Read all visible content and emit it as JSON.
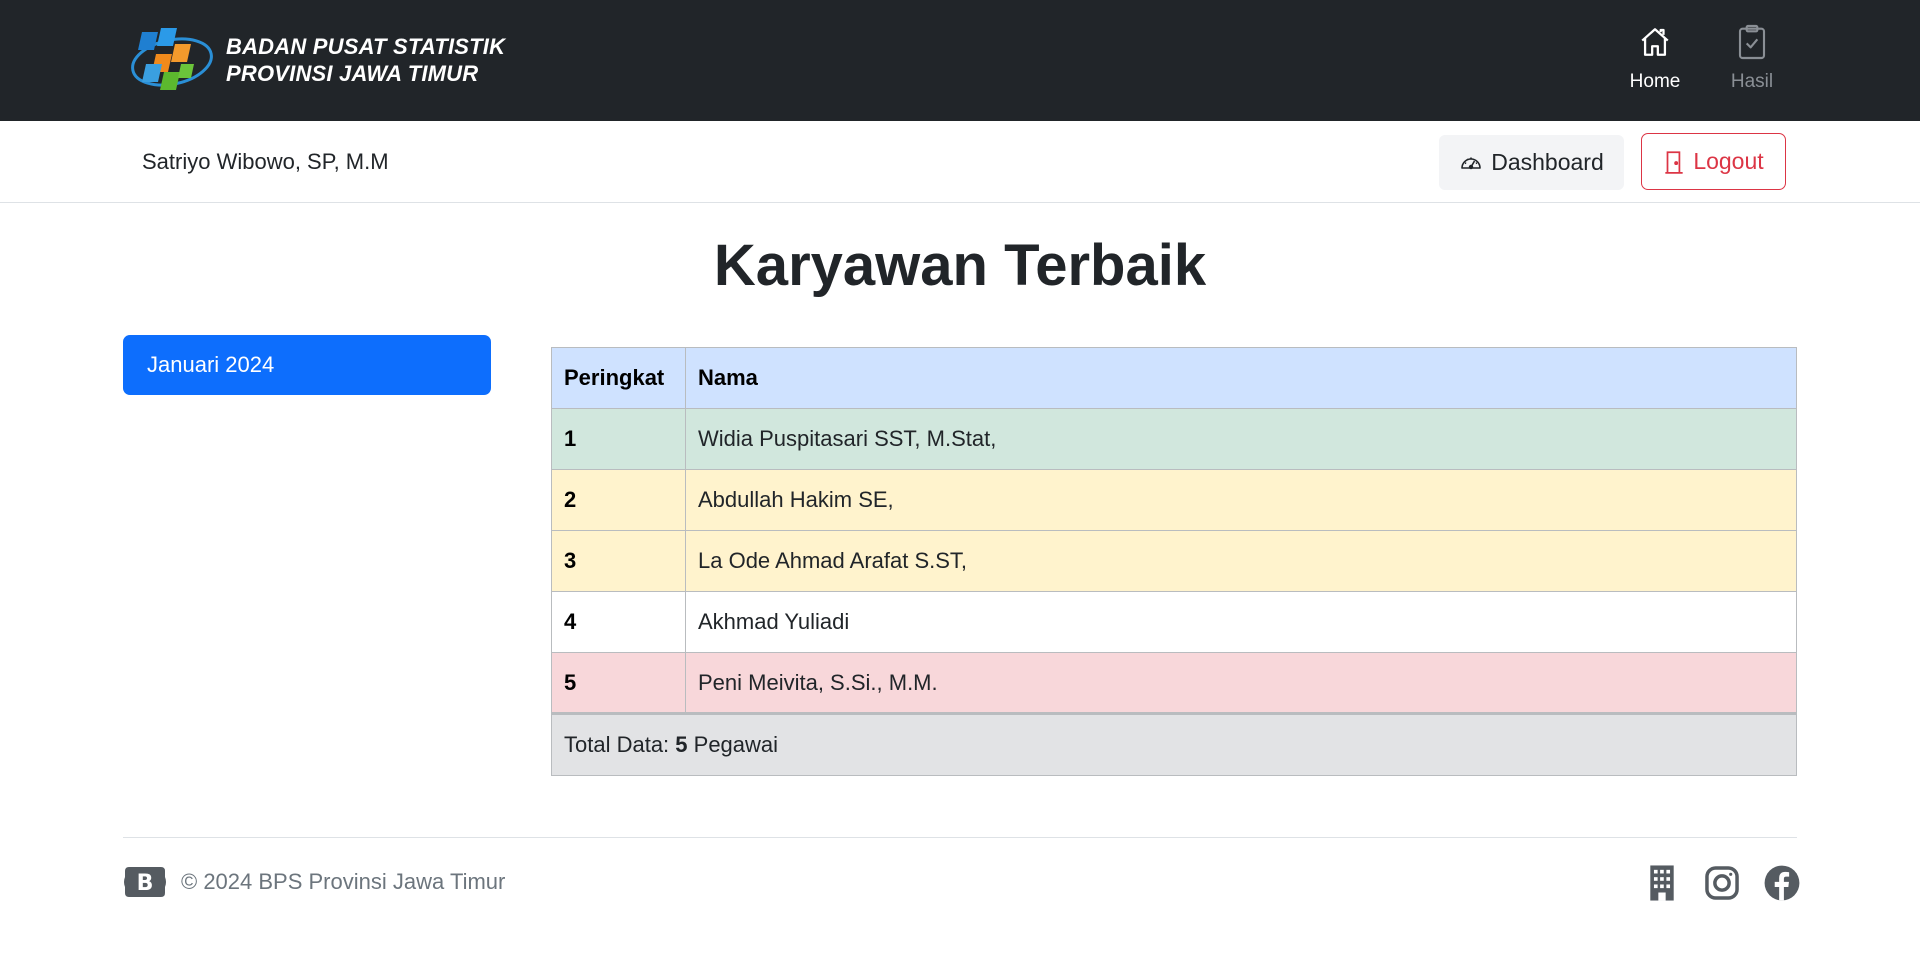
{
  "brand": {
    "line1": "BADAN PUSAT STATISTIK",
    "line2": "PROVINSI JAWA TIMUR"
  },
  "topnav": {
    "home": {
      "label": "Home",
      "icon": "house-icon"
    },
    "hasil": {
      "label": "Hasil",
      "icon": "clipboard-check-icon"
    }
  },
  "subheader": {
    "user_name": "Satriyo Wibowo, SP, M.M",
    "dashboard_label": "Dashboard",
    "logout_label": "Logout"
  },
  "page": {
    "title": "Karyawan Terbaik"
  },
  "sidebar": {
    "items": [
      {
        "label": "Januari 2024",
        "active": true
      }
    ]
  },
  "table": {
    "headers": [
      "Peringkat",
      "Nama"
    ],
    "rows": [
      {
        "rank": "1",
        "name": "Widia Puspitasari SST, M.Stat,"
      },
      {
        "rank": "2",
        "name": "Abdullah Hakim SE,"
      },
      {
        "rank": "3",
        "name": "La Ode Ahmad Arafat S.ST,"
      },
      {
        "rank": "4",
        "name": "Akhmad Yuliadi"
      },
      {
        "rank": "5",
        "name": "Peni Meivita, S.Si., M.M."
      }
    ],
    "footer": {
      "prefix": "Total Data: ",
      "count": "5",
      "suffix": " Pegawai"
    }
  },
  "footer": {
    "copyright": "© 2024 BPS Provinsi Jawa Timur",
    "icons": [
      "building-icon",
      "instagram-icon",
      "facebook-icon"
    ]
  },
  "colors": {
    "navbar": "#212529",
    "primary": "#0d6efd",
    "danger": "#dc3545",
    "table_head": "#cfe2ff",
    "row_success": "#d1e7dd",
    "row_warning": "#fff3cd",
    "row_danger": "#f8d7da",
    "table_foot": "#e2e3e5"
  }
}
